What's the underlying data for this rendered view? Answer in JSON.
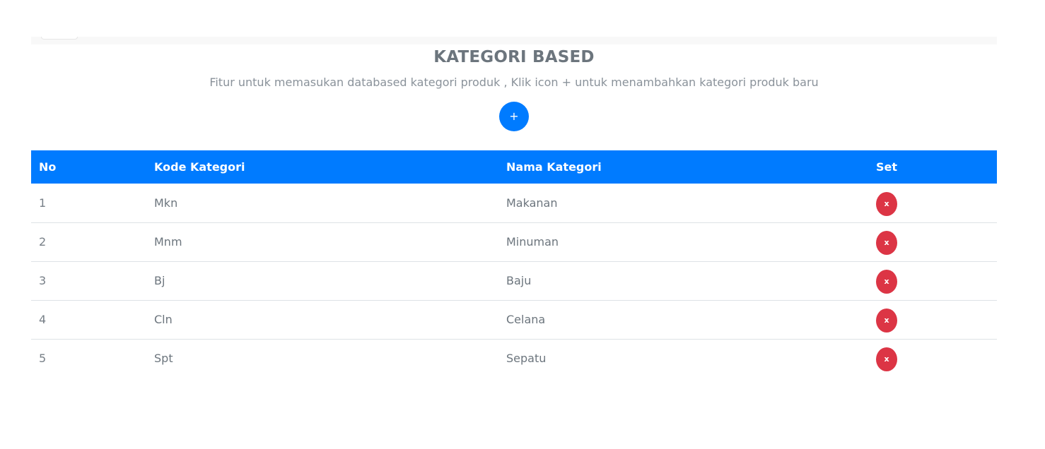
{
  "header": {
    "title": "KATEGORI BASED",
    "subtitle": "Fitur untuk memasukan databased kategori produk , Klik icon + untuk menambahkan kategori produk baru",
    "add_button_label": "+"
  },
  "table": {
    "columns": [
      "No",
      "Kode Kategori",
      "Nama Kategori",
      "Set"
    ],
    "rows": [
      {
        "no": "1",
        "kode": "Mkn",
        "nama": "Makanan",
        "set_label": "x"
      },
      {
        "no": "2",
        "kode": "Mnm",
        "nama": "Minuman",
        "set_label": "x"
      },
      {
        "no": "3",
        "kode": "Bj",
        "nama": "Baju",
        "set_label": "x"
      },
      {
        "no": "4",
        "kode": "Cln",
        "nama": "Celana",
        "set_label": "x"
      },
      {
        "no": "5",
        "kode": "Spt",
        "nama": "Sepatu",
        "set_label": "x"
      }
    ]
  },
  "colors": {
    "primary": "#007bff",
    "danger": "#dc3545",
    "muted_text": "#6c757d",
    "row_divider": "#dee2e6"
  }
}
